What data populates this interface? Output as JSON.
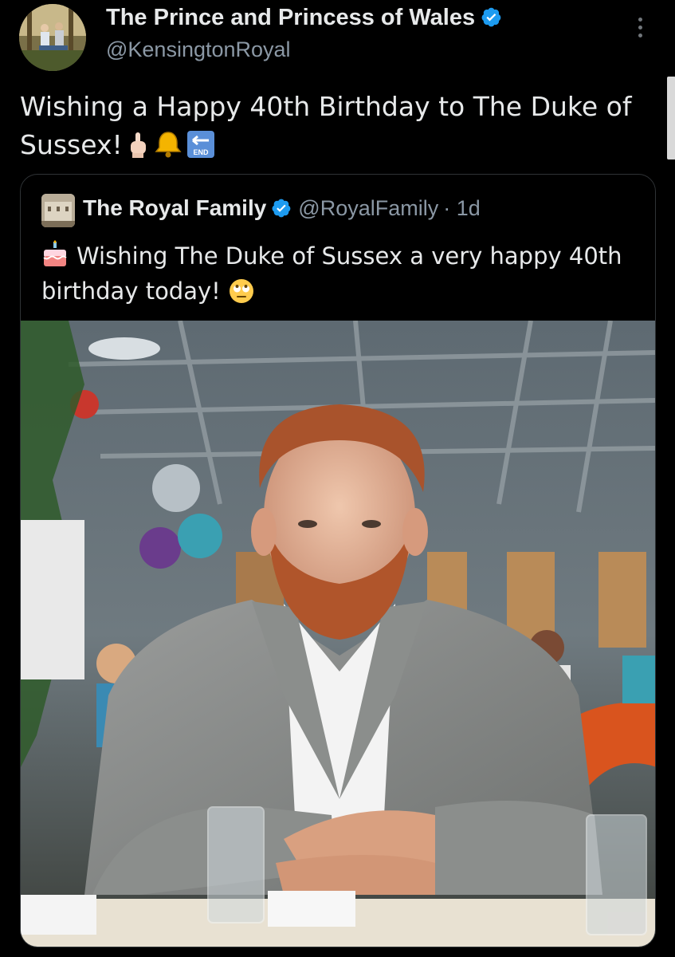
{
  "author": {
    "name": "The Prince and Princess of Wales",
    "handle": "@KensingtonRoyal",
    "verified": true,
    "avatar_icon": "family-photo-avatar"
  },
  "tweet": {
    "text": "Wishing a Happy 40th Birthday to The Duke of Sussex!",
    "emoji_icons": [
      "middle-finger-emoji",
      "bell-emoji",
      "end-arrow-emoji"
    ]
  },
  "quoted": {
    "name": "The Royal Family",
    "handle": "@RoyalFamily",
    "time": "· 1d",
    "verified": true,
    "lead_emoji_icon": "birthday-cake-emoji",
    "text": "Wishing The Duke of Sussex a very happy 40th birthday today!",
    "trail_emoji_icon": "eye-roll-emoji",
    "photo_icon": "portrait-photo"
  },
  "colors": {
    "background": "#000000",
    "text": "#e7e9ea",
    "muted": "#8b98a5",
    "verified": "#1d9bf0",
    "border": "#2f3336"
  }
}
